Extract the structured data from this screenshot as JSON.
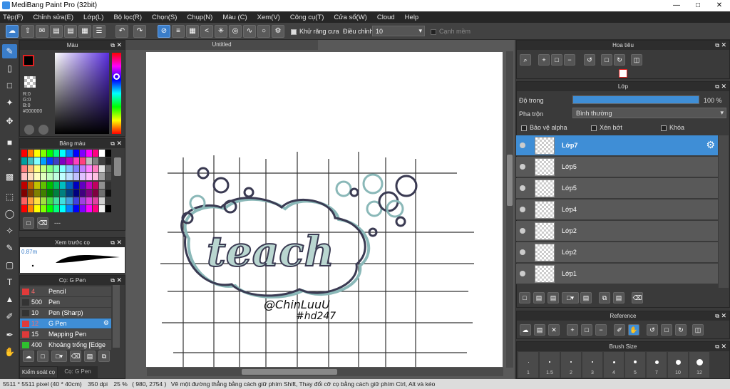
{
  "app": {
    "title": "MediBang Paint Pro (32bit)"
  },
  "menu": [
    "Tệp(F)",
    "Chỉnh sửa(E)",
    "Lớp(L)",
    "Bộ lọc(R)",
    "Chọn(S)",
    "Chụp(N)",
    "Màu (C)",
    "Xem(V)",
    "Công cụ(T)",
    "Cửa sổ(W)",
    "Cloud",
    "Help"
  ],
  "toolbar": {
    "antialias_label": "Khử răng cưa",
    "adjust_label": "Điều chỉnh",
    "adjust_value": "10",
    "sharp_edge_label": "Cạnh mềm"
  },
  "color_panel": {
    "title": "Màu",
    "r": "R:0",
    "g": "G:0",
    "b": "B:0",
    "hex": "#000000"
  },
  "palette": {
    "title": "Bảng màu",
    "dash": "---"
  },
  "brush_preview": {
    "title": "Xem trước cọ",
    "size": "0.87m"
  },
  "brush_panel": {
    "title": "Cọ: G Pen",
    "items": [
      {
        "size": "4",
        "name": "Pencil",
        "color": "#e03a3a"
      },
      {
        "size": "500",
        "name": "Pen",
        "color": "#333333"
      },
      {
        "size": "10",
        "name": "Pen (Sharp)",
        "color": "#333333"
      },
      {
        "size": "12",
        "name": "G Pen",
        "color": "#e03a3a"
      },
      {
        "size": "15",
        "name": "Mapping Pen",
        "color": "#e03a3a"
      },
      {
        "size": "400",
        "name": "Khoảng trống [Edge",
        "color": "#2ec22e"
      }
    ]
  },
  "bottom_tabs": {
    "control": "Kiểm soát cọ",
    "brush": "Cọ: G Pen"
  },
  "canvas": {
    "tab": "Untitled",
    "text_main": "teach",
    "signature": "@ChinLuuU",
    "hashtag": "#hd247"
  },
  "navigator": {
    "title": "Hoa tiêu"
  },
  "layers": {
    "title": "Lớp",
    "opacity_label": "Độ trong",
    "opacity_value": "100 %",
    "opacity_fraction": 1.0,
    "blend_label": "Pha trộn",
    "blend_value": "Bình thường",
    "protect_alpha": "Bảo vệ alpha",
    "clip": "Xén bớt",
    "lock": "Khóa",
    "items": [
      "Lớp7",
      "Lớp5",
      "Lớp5",
      "Lớp4",
      "Lớp2",
      "Lớp2",
      "Lớp1"
    ]
  },
  "reference": {
    "title": "Reference"
  },
  "brush_size": {
    "title": "Brush Size",
    "labels": [
      "1",
      "1.5",
      "2",
      "3",
      "4",
      "5",
      "7",
      "10",
      "12"
    ]
  },
  "status": {
    "dims": "5511 * 5511 pixel",
    "cm": "(40 * 40cm)",
    "dpi": "350 dpi",
    "zoom": "25 %",
    "coords": "( 980, 2754 )",
    "hint": "Vẽ một đường thẳng bằng cách giữ phím Shift, Thay đổi cỡ cọ bằng cách giữ phím Ctrl, Alt và kéo"
  }
}
